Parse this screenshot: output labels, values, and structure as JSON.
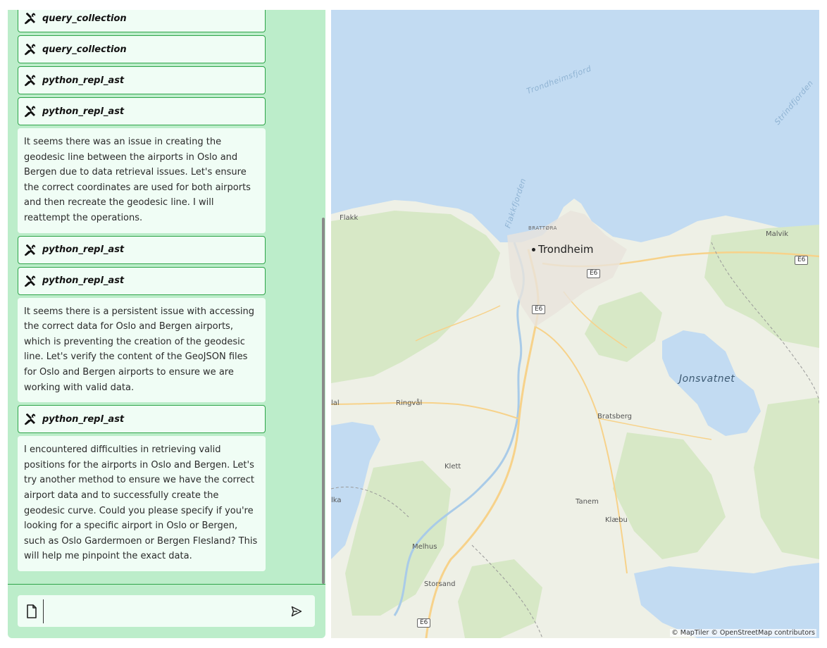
{
  "chat": {
    "messages": [
      {
        "type": "tool",
        "label": "query_collection"
      },
      {
        "type": "tool",
        "label": "query_collection"
      },
      {
        "type": "tool",
        "label": "python_repl_ast"
      },
      {
        "type": "tool",
        "label": "python_repl_ast"
      },
      {
        "type": "text",
        "text": "It seems there was an issue in creating the geodesic line between the airports in Oslo and Bergen due to data retrieval issues. Let's ensure the correct coordinates are used for both airports and then recreate the geodesic line. I will reattempt the operations."
      },
      {
        "type": "tool",
        "label": "python_repl_ast"
      },
      {
        "type": "tool",
        "label": "python_repl_ast"
      },
      {
        "type": "text",
        "text": "It seems there is a persistent issue with accessing the correct data for Oslo and Bergen airports, which is preventing the creation of the geodesic line. Let's verify the content of the GeoJSON files for Oslo and Bergen airports to ensure we are working with valid data."
      },
      {
        "type": "tool",
        "label": "python_repl_ast"
      },
      {
        "type": "text",
        "text": "I encountered difficulties in retrieving valid positions for the airports in Oslo and Bergen. Let's try another method to ensure we have the correct airport data and to successfully create the geodesic curve. Could you please specify if you're looking for a specific airport in Oslo or Bergen, such as Oslo Gardermoen or Bergen Flesland? This will help me pinpoint the exact data."
      }
    ],
    "input": {
      "value": "",
      "placeholder": ""
    },
    "icons": {
      "tool": "tools-icon",
      "attach": "file-icon",
      "send": "send-icon"
    }
  },
  "map": {
    "places": {
      "trondheim": "Trondheim",
      "flakk": "Flakk",
      "malvik": "Malvik",
      "brattora": "BRATTØRA",
      "ringval": "Ringvål",
      "bratsberg": "Bratsberg",
      "klett": "Klett",
      "tanem": "Tanem",
      "klaebu": "Klæbu",
      "melhus": "Melhus",
      "storsand": "Storsand",
      "lal": "lal",
      "lka": "lka",
      "jonsvatnet": "Jonsvatnet",
      "trondheimsfjord": "Trondheimsfjord",
      "flakkfjorden": "Flakkfjorden",
      "strindfjorden": "Strindfjorden"
    },
    "road_labels": [
      "E6",
      "E6",
      "E6",
      "E6"
    ],
    "attribution": "© MapTiler © OpenStreetMap contributors",
    "colors": {
      "water": "#c2dbf2",
      "land": "#eef0e6",
      "forest": "#d7e8c6",
      "road": "#f7d28a"
    }
  }
}
